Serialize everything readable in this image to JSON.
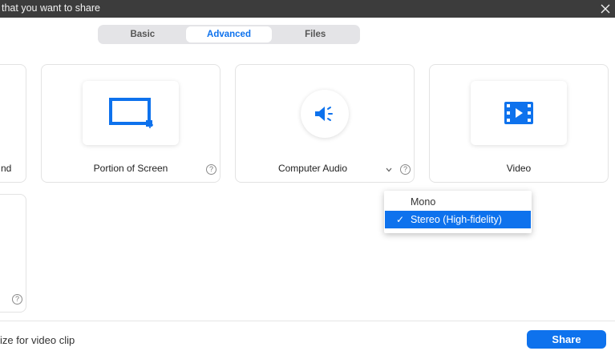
{
  "window": {
    "title": "that you want to share"
  },
  "tabs": [
    {
      "label": "Basic",
      "active": false
    },
    {
      "label": "Advanced",
      "active": true
    },
    {
      "label": "Files",
      "active": false
    }
  ],
  "cards": {
    "left_partial": {
      "label": "nd"
    },
    "portion_of_screen": {
      "label": "Portion of Screen",
      "help": "?"
    },
    "computer_audio": {
      "label": "Computer Audio",
      "help": "?"
    },
    "video": {
      "label": "Video"
    },
    "bottom_partial": {
      "help": "?"
    }
  },
  "audio_dropdown": {
    "options": [
      {
        "label": "Mono",
        "selected": false
      },
      {
        "label": "Stereo (High-fidelity)",
        "selected": true
      }
    ],
    "check_glyph": "✓"
  },
  "footer": {
    "optimize_text": "ize for video clip",
    "share_label": "Share"
  },
  "colors": {
    "accent": "#0e72ed",
    "titlebar": "#3c3c3c"
  },
  "icons": [
    "close-icon",
    "portion-of-screen-icon",
    "speaker-icon",
    "video-film-icon",
    "help-icon",
    "chevron-down-icon",
    "checkmark-icon"
  ]
}
